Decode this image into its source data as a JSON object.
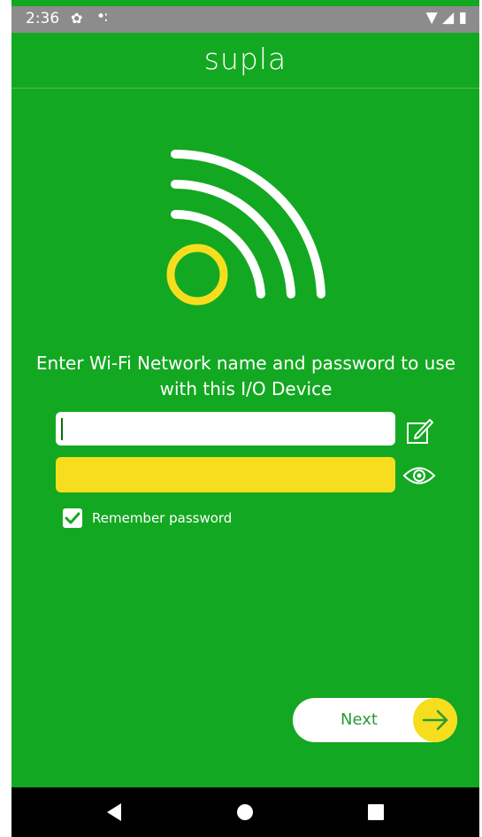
{
  "status_bar": {
    "time": "2:36",
    "icons": [
      "gear-icon",
      "notification-dots-icon",
      "wifi-icon",
      "signal-icon",
      "battery-icon"
    ]
  },
  "app": {
    "title": "supla"
  },
  "instruction": "Enter Wi-Fi Network name and password to use with this I/O Device",
  "form": {
    "ssid_value": "",
    "password_value": "",
    "remember_label": "Remember password",
    "remember_checked": true
  },
  "next_button": {
    "label": "Next"
  },
  "nav": {
    "buttons": [
      "back-icon",
      "home-icon",
      "recents-icon"
    ]
  },
  "colors": {
    "background": "#13a821",
    "accent_yellow": "#f6de1e",
    "white": "#ffffff"
  }
}
